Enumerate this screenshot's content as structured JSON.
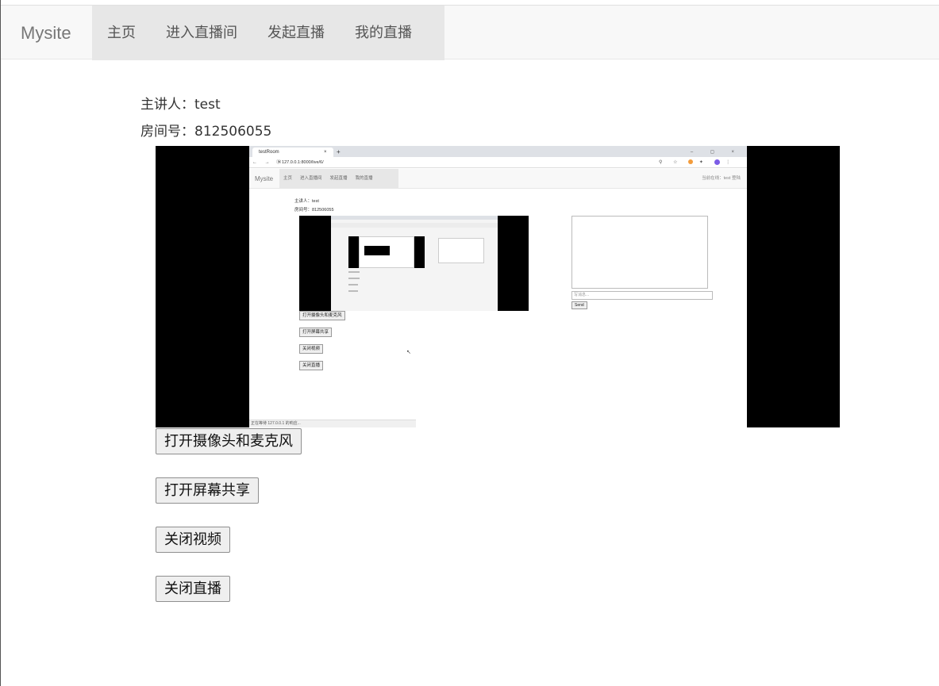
{
  "navbar": {
    "brand": "Mysite",
    "items": [
      {
        "label": "主页"
      },
      {
        "label": "进入直播间"
      },
      {
        "label": "发起直播"
      },
      {
        "label": "我的直播"
      }
    ]
  },
  "room": {
    "host_line": "主讲人：test",
    "room_line": "房间号：812506055"
  },
  "buttons": {
    "open_camera_mic": "打开摄像头和麦克风",
    "open_screen_share": "打开屏幕共享",
    "close_video": "关闭视频",
    "close_live": "关闭直播"
  },
  "shared_screen": {
    "tab_title": "testRoom",
    "tab_close": "×",
    "new_tab": "+",
    "window_controls": "–  ◻  ×",
    "nav_buttons": "←  →  ✕",
    "url": "ⓘ 127.0.0.1:8000/live/6/",
    "brand": "Mysite",
    "nav_items": [
      "主页",
      "进入直播间",
      "发起直播",
      "我的直播"
    ],
    "nav_right": "当前在线：test   登陆",
    "host_line": "主讲人：test",
    "room_line": "房间号：812506055",
    "buttons": [
      "打开摄像头和麦克风",
      "打开屏幕共享",
      "关闭视频",
      "关闭直播"
    ],
    "message_placeholder": "写消息...",
    "send_label": "Send",
    "status_text": "正在等待 127.0.0.1 的响应..."
  },
  "colors": {
    "navbar_bg": "#f8f8f8",
    "nav_active_bg": "#e7e7e7",
    "video_bg": "#000000",
    "button_bg": "#efefef"
  }
}
